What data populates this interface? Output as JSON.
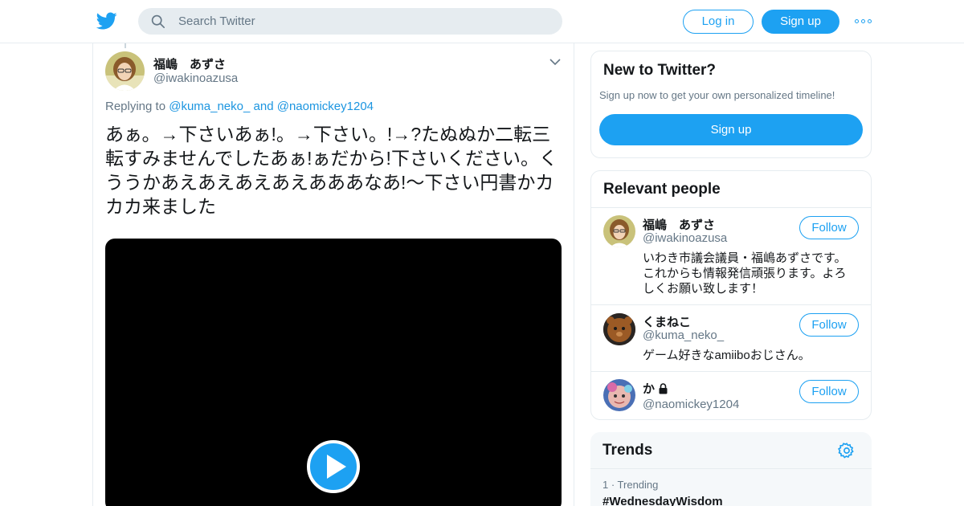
{
  "header": {
    "search_placeholder": "Search Twitter",
    "login_label": "Log in",
    "signup_label": "Sign up",
    "brand_color": "#1da1f2"
  },
  "tweet": {
    "author_name": "福嶋　あずさ",
    "author_handle": "@iwakinoazusa",
    "replying_prefix": "Replying to",
    "reply_to_1": "@kuma_neko_",
    "reply_and": "and",
    "reply_to_2": "@naomickey1204",
    "text": "あぁ。→下さいあぁ!。→下さい。!→?たぬぬか二転三転すみませんでしたあぁ!ぁだから!下さいください。くううかあえあえあえあえあああなあ!〜下さい円書かカカカ来ました",
    "media_icon": "play-icon"
  },
  "sidebar": {
    "new_card": {
      "title": "New to Twitter?",
      "subtitle": "Sign up now to get your own personalized timeline!",
      "signup_label": "Sign up"
    },
    "relevant": {
      "title": "Relevant people",
      "people": [
        {
          "name": "福嶋　あずさ",
          "handle": "@iwakinoazusa",
          "bio": "いわき市議会議員・福嶋あずさです。これからも情報発信頑張ります。よろしくお願い致します！",
          "follow_label": "Follow"
        },
        {
          "name": "くまねこ",
          "handle": "@kuma_neko_",
          "bio": "ゲーム好きなamiiboおじさん。",
          "follow_label": "Follow"
        },
        {
          "name": "か",
          "handle": "@naomickey1204",
          "bio": "",
          "follow_label": "Follow",
          "protected_icon": "lock-icon"
        }
      ]
    },
    "trends": {
      "title": "Trends",
      "items": [
        {
          "meta": "1 · Trending",
          "name": "#WednesdayWisdom"
        }
      ]
    }
  }
}
